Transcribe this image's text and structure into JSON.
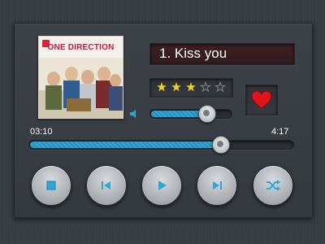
{
  "player": {
    "cover": {
      "band_name": "ONE DIRECTION",
      "logo_icon": "band-logo-icon"
    },
    "track_title": "1. Kiss you",
    "rating": {
      "value": 3,
      "max": 5,
      "icon": "star-icon"
    },
    "favorite": {
      "icon": "heart-icon",
      "active": true,
      "color": "#e0141c"
    },
    "volume": {
      "icon": "speaker-icon",
      "level": 0.7
    },
    "progress": {
      "elapsed": "03:10",
      "total": "4:17",
      "fraction": 0.74
    },
    "controls": [
      {
        "name": "stop",
        "icon": "stop-icon"
      },
      {
        "name": "previous",
        "icon": "skip-back-icon"
      },
      {
        "name": "play",
        "icon": "play-icon"
      },
      {
        "name": "next",
        "icon": "skip-forward-icon"
      },
      {
        "name": "shuffle",
        "icon": "shuffle-icon"
      }
    ],
    "colors": {
      "accent": "#2fa6d4",
      "star": "#f2d31a",
      "title_bg": "#3b1e22",
      "panel": "#3a3f45"
    }
  }
}
